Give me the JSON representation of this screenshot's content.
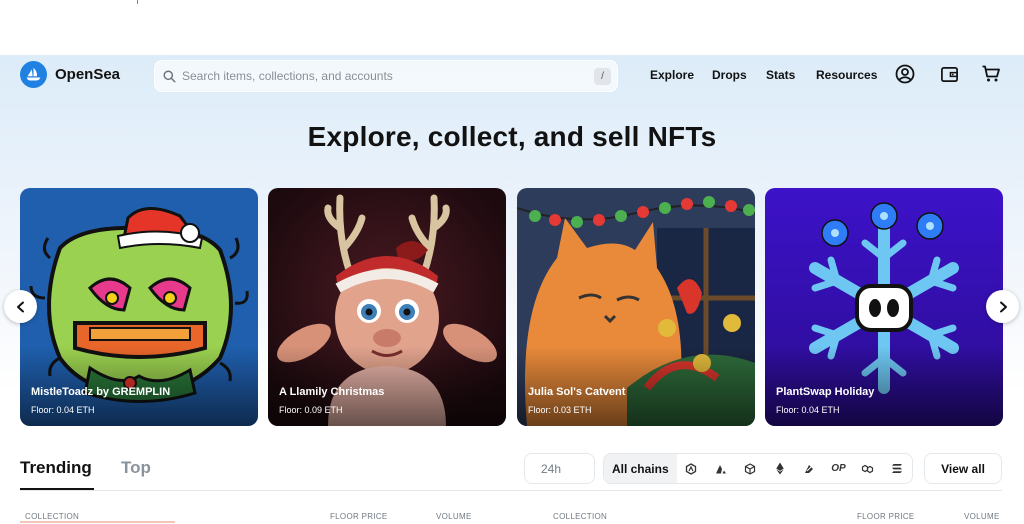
{
  "header": {
    "brand": "OpenSea",
    "search_placeholder": "Search items, collections, and accounts",
    "search_shortcut": "/",
    "nav": [
      "Explore",
      "Drops",
      "Stats",
      "Resources"
    ],
    "icons": [
      "profile-icon",
      "wallet-icon",
      "cart-icon"
    ]
  },
  "hero": {
    "title": "Explore, collect, and sell NFTs"
  },
  "carousel": {
    "cards": [
      {
        "name": "MistleToadz by GREMPLIN",
        "floor": "Floor: 0.04 ETH"
      },
      {
        "name": "A Llamily Christmas",
        "floor": "Floor: 0.09 ETH"
      },
      {
        "name": "Julia Sol's Catvent",
        "floor": "Floor: 0.03 ETH"
      },
      {
        "name": "PlantSwap Holiday",
        "floor": "Floor: 0.04 ETH"
      }
    ]
  },
  "trending": {
    "tabs": [
      "Trending",
      "Top"
    ],
    "active_tab": "Trending",
    "time_range": "24h",
    "chains_all_label": "All chains",
    "chain_icons": [
      "arbitrum-icon",
      "avalanche-icon",
      "base-icon",
      "ethereum-icon",
      "blast-icon",
      "optimism-icon",
      "polygon-icon",
      "solana-icon"
    ],
    "optimism_label": "OP",
    "view_all_label": "View all",
    "columns_left": [
      "COLLECTION",
      "FLOOR PRICE",
      "VOLUME"
    ],
    "columns_right": [
      "COLLECTION",
      "FLOOR PRICE",
      "VOLUME"
    ]
  },
  "colors": {
    "brand_blue": "#2081e2",
    "text": "#121212",
    "muted": "#707a83"
  }
}
